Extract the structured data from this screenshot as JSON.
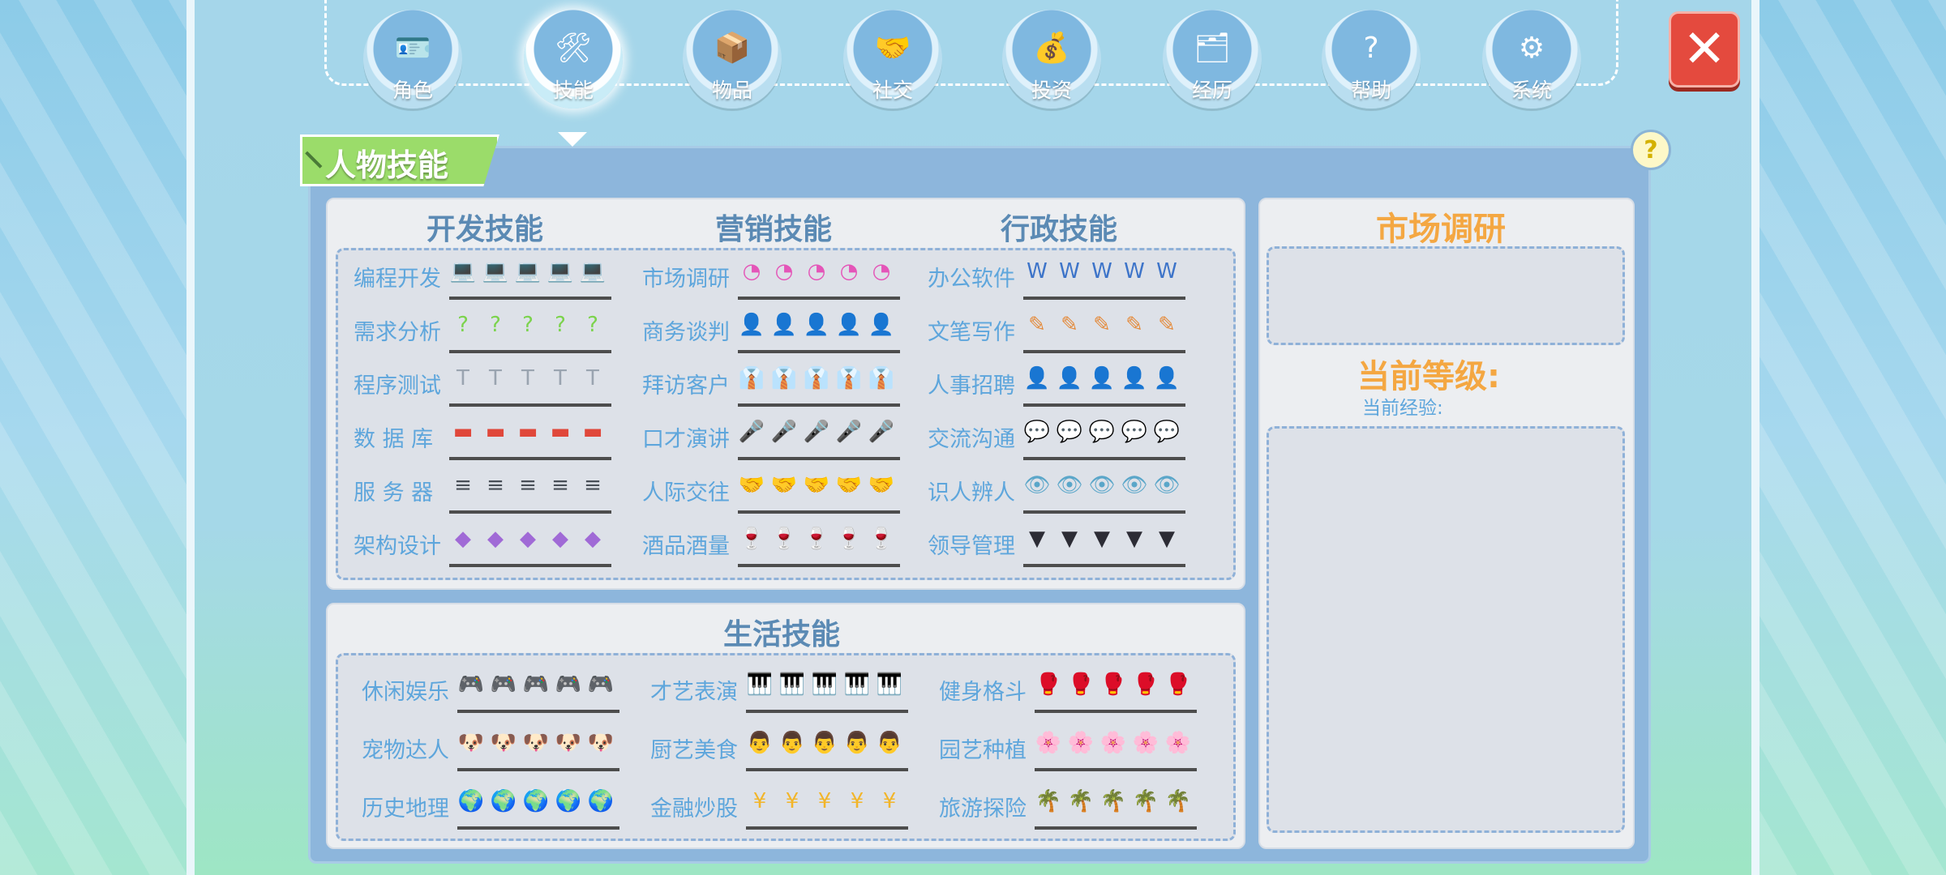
{
  "nav": [
    {
      "label": "角色",
      "icon": "id-card-icon",
      "glyph": "🪪"
    },
    {
      "label": "技能",
      "icon": "tools-icon",
      "glyph": "🛠"
    },
    {
      "label": "物品",
      "icon": "box-icon",
      "glyph": "📦"
    },
    {
      "label": "社交",
      "icon": "handshake-icon",
      "glyph": "🤝"
    },
    {
      "label": "投资",
      "icon": "invest-icon",
      "glyph": "💰"
    },
    {
      "label": "经历",
      "icon": "history-icon",
      "glyph": "🗂"
    },
    {
      "label": "帮助",
      "icon": "help-icon",
      "glyph": "?"
    },
    {
      "label": "系统",
      "icon": "gear-icon",
      "glyph": "⚙"
    }
  ],
  "close_glyph": "✕",
  "panel_title": "人物技能",
  "help_glyph": "?",
  "work_skills": {
    "dev": {
      "title": "开发技能",
      "items": [
        {
          "name": "编程开发",
          "icon": "laptop-icon",
          "glyph": "💻",
          "color": "#3c4b5e"
        },
        {
          "name": "需求分析",
          "icon": "question-bubble-icon",
          "glyph": "?",
          "color": "#7bd34c"
        },
        {
          "name": "程序测试",
          "icon": "test-sheet-icon",
          "glyph": "T",
          "color": "#9aa4b0"
        },
        {
          "name": "数 据 库",
          "icon": "database-icon",
          "glyph": "▬",
          "color": "#e0473a"
        },
        {
          "name": "服 务 器",
          "icon": "server-icon",
          "glyph": "≡",
          "color": "#484f57"
        },
        {
          "name": "架构设计",
          "icon": "cubes-icon",
          "glyph": "◆",
          "color": "#a06ad6"
        }
      ]
    },
    "mkt": {
      "title": "营销技能",
      "items": [
        {
          "name": "市场调研",
          "icon": "pie-chart-icon",
          "glyph": "◔",
          "color": "#e455b8"
        },
        {
          "name": "商务谈判",
          "icon": "negotiation-icon",
          "glyph": "👤",
          "color": "#3a2e29"
        },
        {
          "name": "拜访客户",
          "icon": "visit-client-icon",
          "glyph": "👔",
          "color": "#c0392b"
        },
        {
          "name": "口才演讲",
          "icon": "microphone-icon",
          "glyph": "🎤",
          "color": "#f2c230"
        },
        {
          "name": "人际交往",
          "icon": "handshake-icon",
          "glyph": "🤝",
          "color": "#f0a63a"
        },
        {
          "name": "酒品酒量",
          "icon": "wine-icon",
          "glyph": "🍷",
          "color": "#b02636"
        }
      ]
    },
    "admin": {
      "title": "行政技能",
      "items": [
        {
          "name": "办公软件",
          "icon": "word-doc-icon",
          "glyph": "W",
          "color": "#3d74c9"
        },
        {
          "name": "文笔写作",
          "icon": "book-pen-icon",
          "glyph": "✎",
          "color": "#e48a3a"
        },
        {
          "name": "人事招聘",
          "icon": "recruiter-icon",
          "glyph": "👤",
          "color": "#3a2e29"
        },
        {
          "name": "交流沟通",
          "icon": "chat-bubbles-icon",
          "glyph": "💬",
          "color": "#95d24a"
        },
        {
          "name": "识人辨人",
          "icon": "eye-icon",
          "glyph": "👁",
          "color": "#5aa6c9"
        },
        {
          "name": "领导管理",
          "icon": "suit-icon",
          "glyph": "▼",
          "color": "#2c2c35"
        }
      ]
    }
  },
  "life_skills": {
    "title": "生活技能",
    "cols": [
      [
        {
          "name": "休闲娱乐",
          "icon": "gamepad-icon",
          "glyph": "🎮",
          "color": "#c9ced6"
        },
        {
          "name": "宠物达人",
          "icon": "pug-icon",
          "glyph": "🐶",
          "color": "#c7a98a"
        },
        {
          "name": "历史地理",
          "icon": "globe-book-icon",
          "glyph": "🌍",
          "color": "#3aa25a"
        }
      ],
      [
        {
          "name": "才艺表演",
          "icon": "piano-icon",
          "glyph": "🎹",
          "color": "#2e3470"
        },
        {
          "name": "厨艺美食",
          "icon": "chef-hat-icon",
          "glyph": "👨",
          "color": "#ffffff"
        },
        {
          "name": "金融炒股",
          "icon": "money-bag-icon",
          "glyph": "¥",
          "color": "#f2b529"
        }
      ],
      [
        {
          "name": "健身格斗",
          "icon": "boxing-glove-icon",
          "glyph": "🥊",
          "color": "#d3374a"
        },
        {
          "name": "园艺种植",
          "icon": "flower-pot-icon",
          "glyph": "🌸",
          "color": "#e86fbd"
        },
        {
          "name": "旅游探险",
          "icon": "palm-island-icon",
          "glyph": "🌴",
          "color": "#45b34c"
        }
      ]
    ]
  },
  "detail": {
    "title": "市场调研",
    "level_label": "当前等级:",
    "exp_label": "当前经验:"
  }
}
